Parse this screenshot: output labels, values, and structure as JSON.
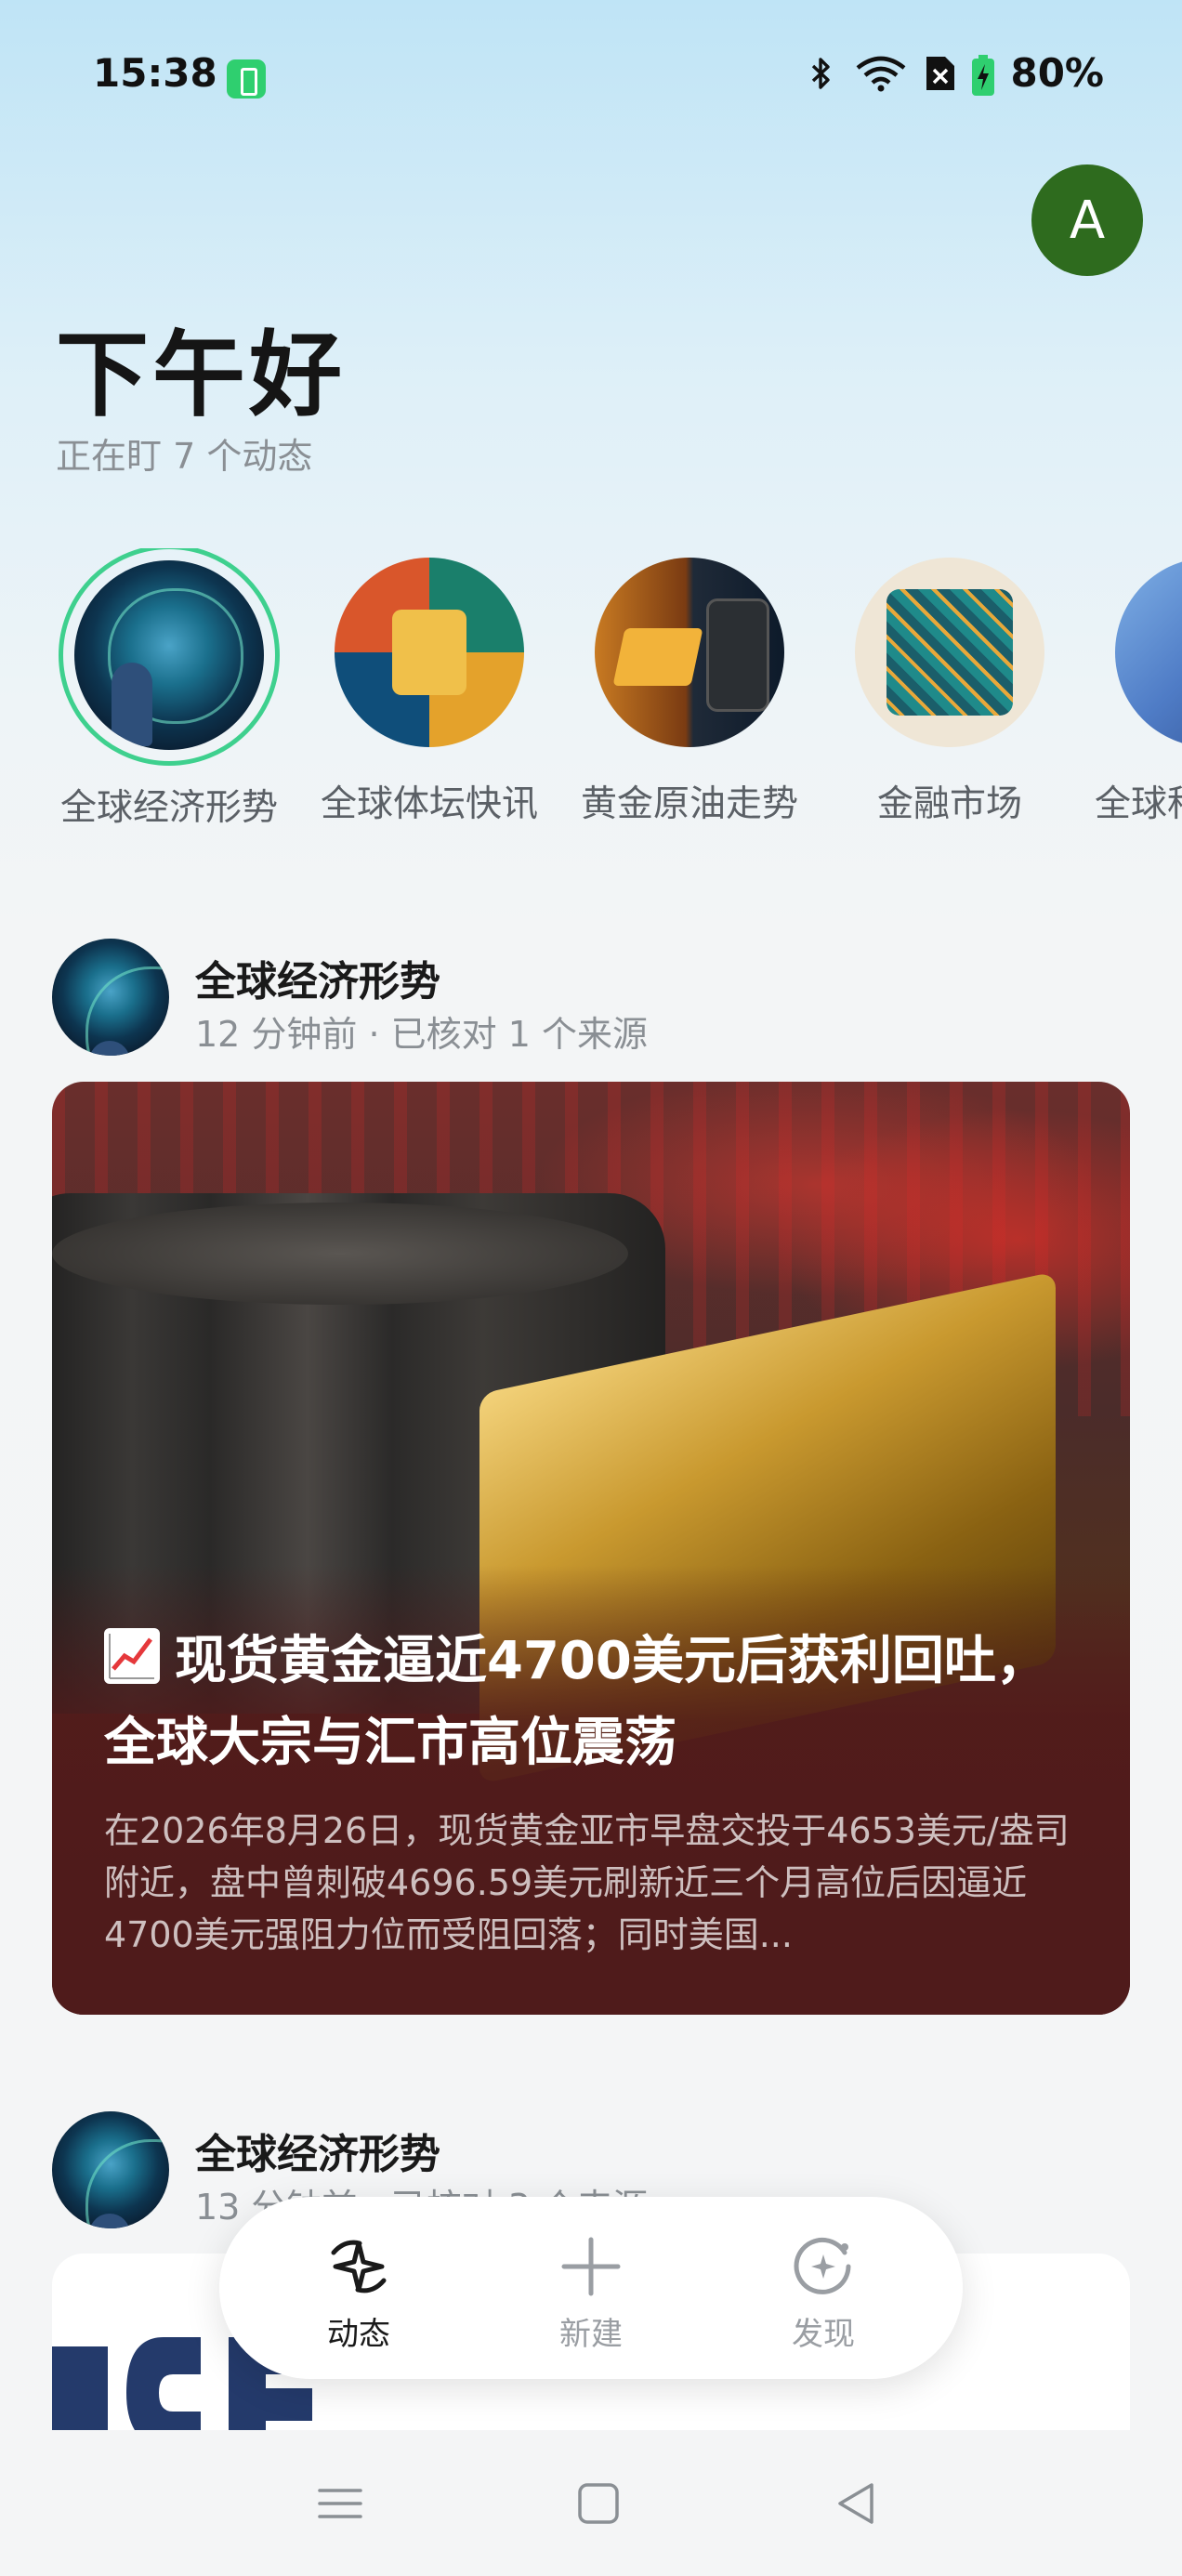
{
  "status_bar": {
    "time": "15:38",
    "battery_percent": "80%",
    "icons": [
      "charging-indicator-icon",
      "bluetooth-icon",
      "wifi-icon",
      "sim-off-icon",
      "battery-charging-icon"
    ]
  },
  "user": {
    "avatar_letter": "A",
    "avatar_color": "#2e6b1e"
  },
  "greeting": {
    "title": "下午好",
    "subtitle": "正在盯 7 个动态"
  },
  "topics": [
    {
      "label": "全球经济形势",
      "selected": true
    },
    {
      "label": "全球体坛快讯",
      "selected": false
    },
    {
      "label": "黄金原油走势",
      "selected": false
    },
    {
      "label": "金融市场",
      "selected": false
    },
    {
      "label": "全球科",
      "selected": false
    }
  ],
  "feed": [
    {
      "topic": "全球经济形势",
      "meta": "12 分钟前 · 已核对 1 个来源",
      "title": "现货黄金逼近4700美元后获利回吐，全球大宗与汇市高位震荡",
      "title_icon": "chart-increasing-emoji",
      "summary": "在2026年8月26日，现货黄金亚市早盘交投于4653美元/盎司附近，盘中曾刺破4696.59美元刷新近三个月高位后因逼近4700美元强阻力位而受阻回落；同时美国..."
    },
    {
      "topic": "全球经济形势",
      "meta": "13 分钟前 · 已核对 3 个来源"
    }
  ],
  "tab_bar": {
    "tabs": [
      {
        "label": "动态",
        "icon": "activity-icon",
        "active": true
      },
      {
        "label": "新建",
        "icon": "plus-icon",
        "active": false
      },
      {
        "label": "发现",
        "icon": "discover-icon",
        "active": false
      }
    ]
  },
  "system_nav": {
    "buttons": [
      "menu-icon",
      "home-icon",
      "back-icon"
    ]
  },
  "colors": {
    "accent_ring": "#3ed08e",
    "card_bg": "#4f1b1b",
    "muted_text": "#8a8f94"
  }
}
